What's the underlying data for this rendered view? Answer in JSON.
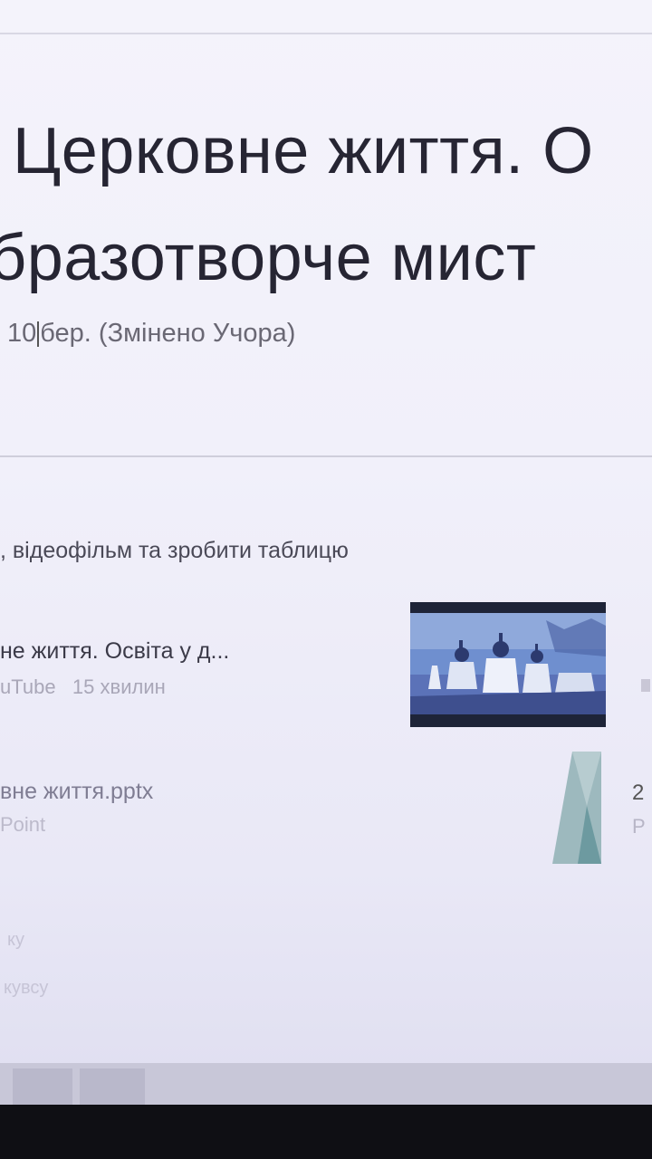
{
  "assignment": {
    "title_line1": "Церковне життя. О",
    "title_line2": "бразотворче мист",
    "meta_prefix": "10",
    "meta_rest": "бер. (Змінено Учора)"
  },
  "instructions": {
    "text": ", відеофільм та зробити таблицю"
  },
  "attachments": [
    {
      "title": "не життя. Освіта у д...",
      "source": "uTube",
      "duration": "15 хвилин",
      "icon": "video-thumbnail"
    },
    {
      "title": "вне життя.pptx",
      "type": "Point",
      "icon": "powerpoint-icon"
    }
  ],
  "right_edge": {
    "number": "2",
    "letter": "P"
  },
  "faint_labels": [
    "ку",
    "кувсу"
  ],
  "colors": {
    "title": "#262533",
    "background": "#f2f1fa",
    "thumbnail_dark": "#222a40",
    "ppt_accent": "#7fa7a8"
  }
}
